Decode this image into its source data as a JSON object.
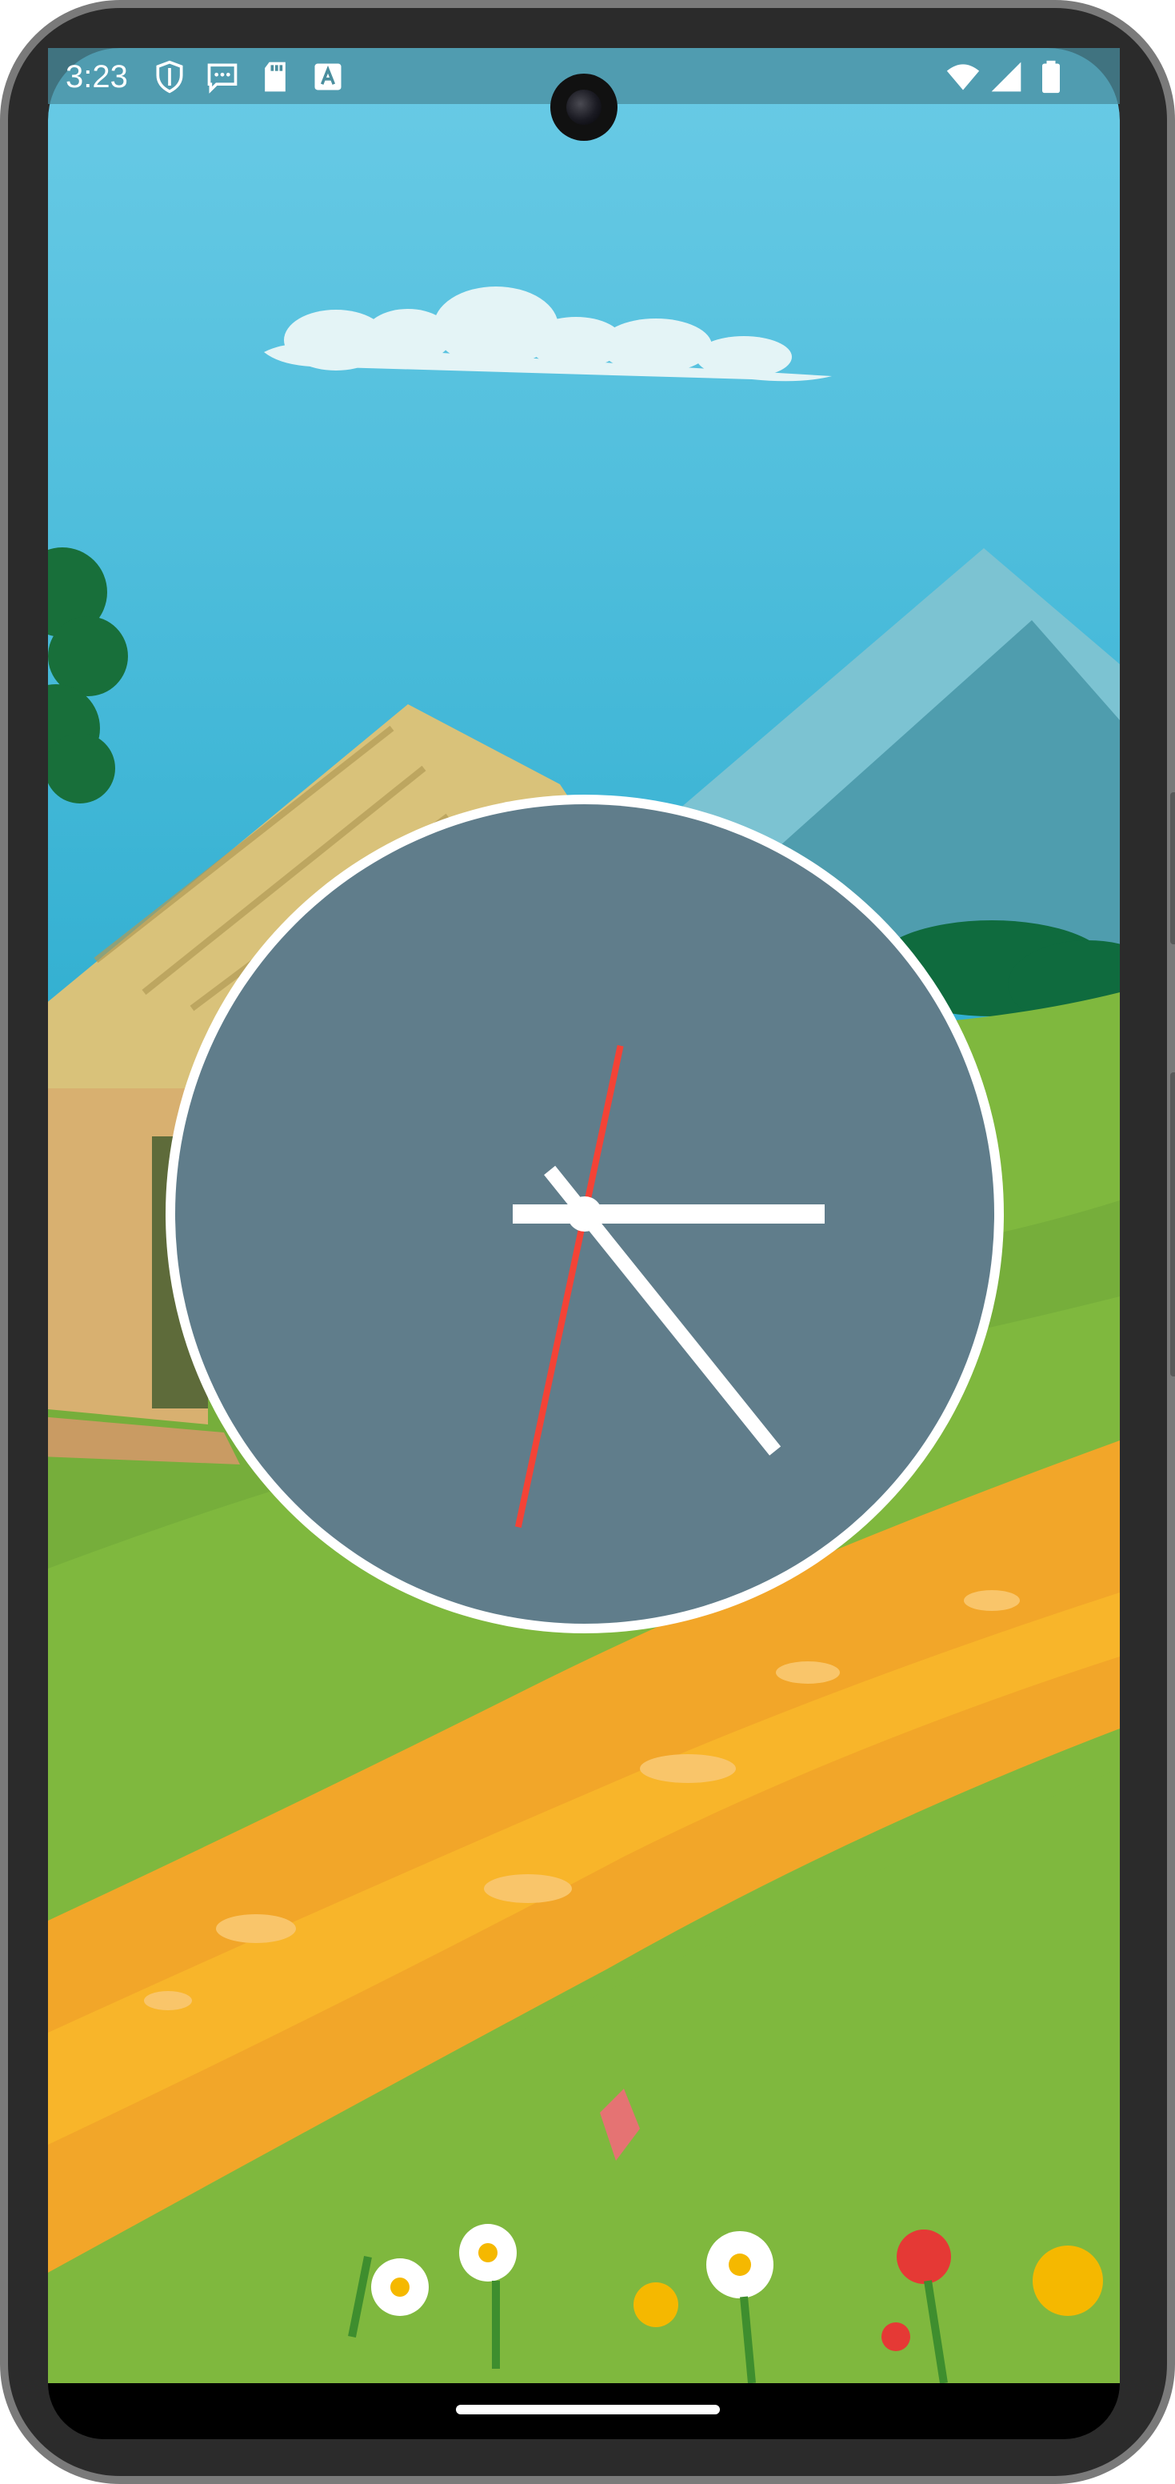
{
  "status_bar": {
    "time": "3:23",
    "icons": [
      "shield-icon",
      "message-icon",
      "sd-card-icon",
      "text-a-icon"
    ],
    "right_icons": [
      "wifi-icon",
      "signal-icon",
      "battery-icon"
    ]
  },
  "wallpaper": {
    "scene": "cartoon-countryside",
    "colors": {
      "sky_top": "#6ACBE6",
      "sky_bottom": "#2FAED0",
      "grass": "#7FB83E",
      "path": "#F5A623",
      "mountain": "#5BA3B4"
    }
  },
  "clock": {
    "hours": 3,
    "minutes": 23,
    "seconds": 32,
    "colors": {
      "face": "#607D8B",
      "rim": "#FFFFFF",
      "hands": "#FFFFFF",
      "second_hand": "#F44336"
    }
  },
  "nav": {
    "home_indicator": "home-gesture-bar"
  }
}
